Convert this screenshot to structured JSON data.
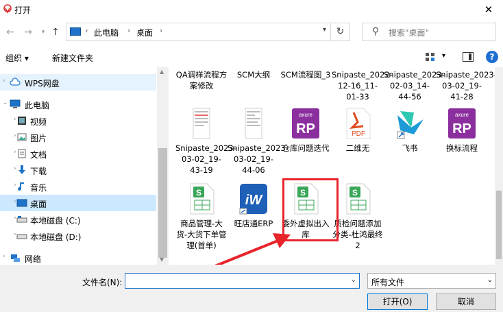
{
  "window": {
    "title": "打开",
    "close": "✕"
  },
  "address": {
    "crumbs": [
      "此电脑",
      "桌面"
    ],
    "search_placeholder": "搜索\"桌面\""
  },
  "toolbar": {
    "organize": "组织 ▾",
    "new_folder": "新建文件夹"
  },
  "nav": {
    "items": [
      {
        "label": "WPS网盘",
        "icon": "cloud-icon"
      },
      {
        "label": "此电脑",
        "icon": "computer-icon"
      },
      {
        "label": "视频",
        "icon": "video-icon"
      },
      {
        "label": "图片",
        "icon": "pictures-icon"
      },
      {
        "label": "文档",
        "icon": "documents-icon"
      },
      {
        "label": "下载",
        "icon": "download-icon"
      },
      {
        "label": "音乐",
        "icon": "music-icon"
      },
      {
        "label": "桌面",
        "icon": "desktop-icon"
      },
      {
        "label": "本地磁盘 (C:)",
        "icon": "drive-icon"
      },
      {
        "label": "本地磁盘 (D:)",
        "icon": "drive-icon"
      },
      {
        "label": "网络",
        "icon": "network-icon"
      }
    ]
  },
  "files": {
    "row0": [
      {
        "label": "QA调样流程方案修改"
      },
      {
        "label": "SCM大纲"
      },
      {
        "label": "SCM流程图_3"
      },
      {
        "label": "Snipaste_2022-12-16_11-01-33"
      },
      {
        "label": "Snipaste_2023-02-03_14-44-56"
      },
      {
        "label": "Snipaste_2023-03-02_19-41-28"
      }
    ],
    "row1": [
      {
        "label": "Snipaste_2023-03-02_19-43-19",
        "icon": "screenshot-thumb-icon"
      },
      {
        "label": "Snipaste_2023-03-02_19-44-06",
        "icon": "screenshot-thumb-icon"
      },
      {
        "label": "仓库问题迭代",
        "icon": "axure-rp-icon",
        "brand": "axure",
        "mark": "RP"
      },
      {
        "label": "二维无",
        "icon": "pdf-icon",
        "mark": "PDF"
      },
      {
        "label": "飞书",
        "icon": "feishu-icon"
      },
      {
        "label": "换标流程",
        "icon": "axure-rp-icon",
        "brand": "axure",
        "mark": "RP"
      }
    ],
    "row2": [
      {
        "label": "商品管理-大货-大货下单管理(首单)",
        "icon": "wps-sheet-icon",
        "mark": "S"
      },
      {
        "label": "旺店通ERP",
        "icon": "wdt-erp-icon",
        "mark": "iW"
      },
      {
        "label": "委外虚拟出入库",
        "icon": "wps-sheet-icon",
        "mark": "S"
      },
      {
        "label": "质检问题添加分类-杜鸿最终2",
        "icon": "wps-sheet-icon",
        "mark": "S"
      }
    ]
  },
  "bottom": {
    "filename_label": "文件名(N):",
    "filename_value": "",
    "filetype": "所有文件",
    "open": "打开(O)",
    "cancel": "取消"
  },
  "colors": {
    "accent": "#0078d7",
    "selection": "#cce8ff",
    "annotation_red": "#e8242b",
    "axure_purple": "#8b2f9e",
    "wps_green": "#3aa65a"
  }
}
